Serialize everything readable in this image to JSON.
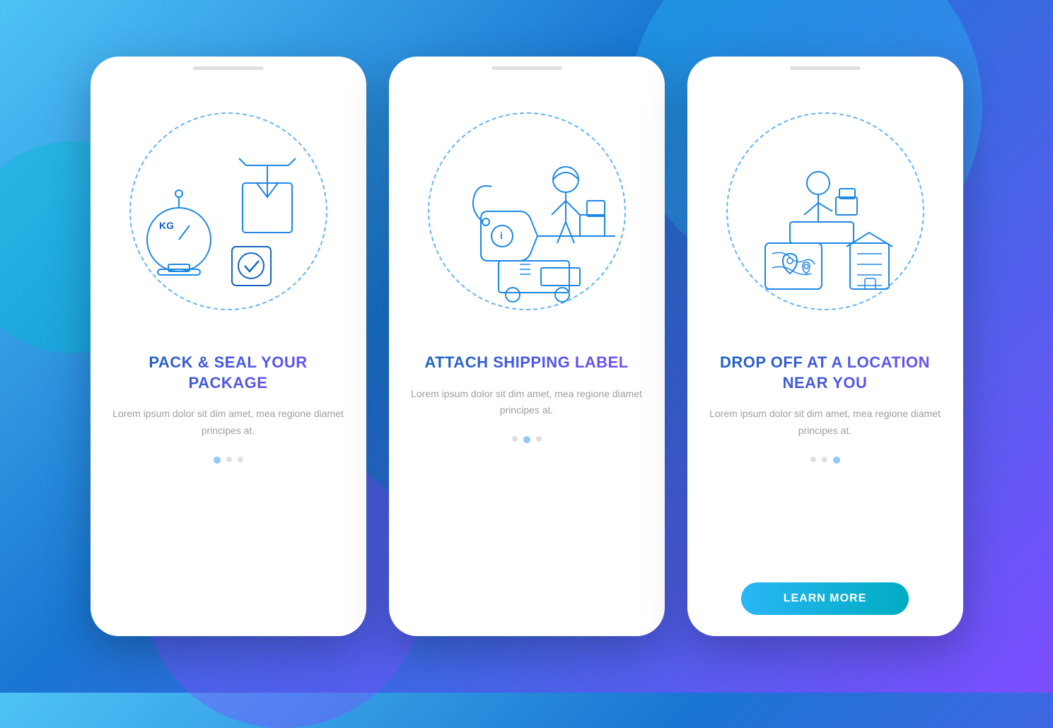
{
  "background": {
    "gradient_start": "#4fc3f7",
    "gradient_end": "#7c4dff"
  },
  "screens": [
    {
      "id": "screen-1",
      "title": "PACK & SEAL\nYOUR PACKAGE",
      "description": "Lorem ipsum dolor sit dim\namet, mea regione diamet\nprincipes at.",
      "dots": [
        {
          "active": true
        },
        {
          "active": false
        },
        {
          "active": false
        }
      ],
      "has_button": false,
      "illustration_type": "pack"
    },
    {
      "id": "screen-2",
      "title": "ATTACH\nSHIPPING LABEL",
      "description": "Lorem ipsum dolor sit dim\namet, mea regione diamet\nprincipes at.",
      "dots": [
        {
          "active": false
        },
        {
          "active": true
        },
        {
          "active": false
        }
      ],
      "has_button": false,
      "illustration_type": "label"
    },
    {
      "id": "screen-3",
      "title": "DROP OFF AT A\nLOCATION NEAR YOU",
      "description": "Lorem ipsum dolor sit dim\namet, mea regione diamet\nprincipes at.",
      "dots": [
        {
          "active": false
        },
        {
          "active": false
        },
        {
          "active": true
        }
      ],
      "has_button": true,
      "button_label": "LEARN MORE",
      "illustration_type": "dropoff"
    }
  ]
}
